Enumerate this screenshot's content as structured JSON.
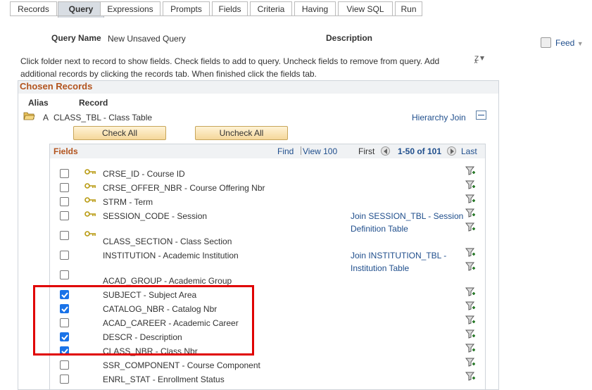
{
  "tabs": [
    "Records",
    "Query",
    "Expressions",
    "Prompts",
    "Fields",
    "Criteria",
    "Having",
    "View SQL",
    "Run"
  ],
  "active_tab": "Query",
  "query_name_label": "Query Name",
  "query_name_value": "New Unsaved Query",
  "description_label": "Description",
  "feed_label": "Feed",
  "instructions": "Click folder next to record to show fields. Check fields to add to query. Uncheck fields to remove from query. Add additional records by clicking the records tab. When finished click the fields tab.",
  "chosen_records_title": "Chosen Records",
  "alias_header": "Alias",
  "record_header": "Record",
  "record_alias": "A",
  "record_name": "CLASS_TBL - Class Table",
  "hierarchy_join": "Hierarchy Join",
  "check_all": "Check All",
  "uncheck_all": "Uncheck All",
  "fields_title": "Fields",
  "find_label": "Find",
  "view_label": "View 100",
  "first_label": "First",
  "page_range": "1-50 of 101",
  "last_label": "Last",
  "fields": [
    {
      "name": "CRSE_ID - Course ID",
      "checked": false,
      "key": true
    },
    {
      "name": "CRSE_OFFER_NBR - Course Offering Nbr",
      "checked": false,
      "key": true
    },
    {
      "name": "STRM - Term",
      "checked": false,
      "key": true
    },
    {
      "name": "SESSION_CODE - Session",
      "checked": false,
      "key": true,
      "join": "Join SESSION_TBL - Session Definition Table"
    },
    {
      "name": "CLASS_SECTION - Class Section",
      "checked": false,
      "key": true
    },
    {
      "name": "INSTITUTION - Academic Institution",
      "checked": false,
      "key": false,
      "join": "Join INSTITUTION_TBL - Institution Table"
    },
    {
      "name": "ACAD_GROUP - Academic Group",
      "checked": false,
      "key": false
    },
    {
      "name": "SUBJECT - Subject Area",
      "checked": true,
      "key": false
    },
    {
      "name": "CATALOG_NBR - Catalog Nbr",
      "checked": true,
      "key": false
    },
    {
      "name": "ACAD_CAREER - Academic Career",
      "checked": false,
      "key": false
    },
    {
      "name": "DESCR - Description",
      "checked": true,
      "key": false
    },
    {
      "name": "CLASS_NBR - Class Nbr",
      "checked": true,
      "key": false
    },
    {
      "name": "SSR_COMPONENT - Course Component",
      "checked": false,
      "key": false
    },
    {
      "name": "ENRL_STAT - Enrollment Status",
      "checked": false,
      "key": false
    }
  ],
  "join_session_line1": "Join SESSION_TBL - Session",
  "join_session_line2": "Definition Table",
  "join_inst_line1": "Join INSTITUTION_TBL -",
  "join_inst_line2": "Institution Table"
}
